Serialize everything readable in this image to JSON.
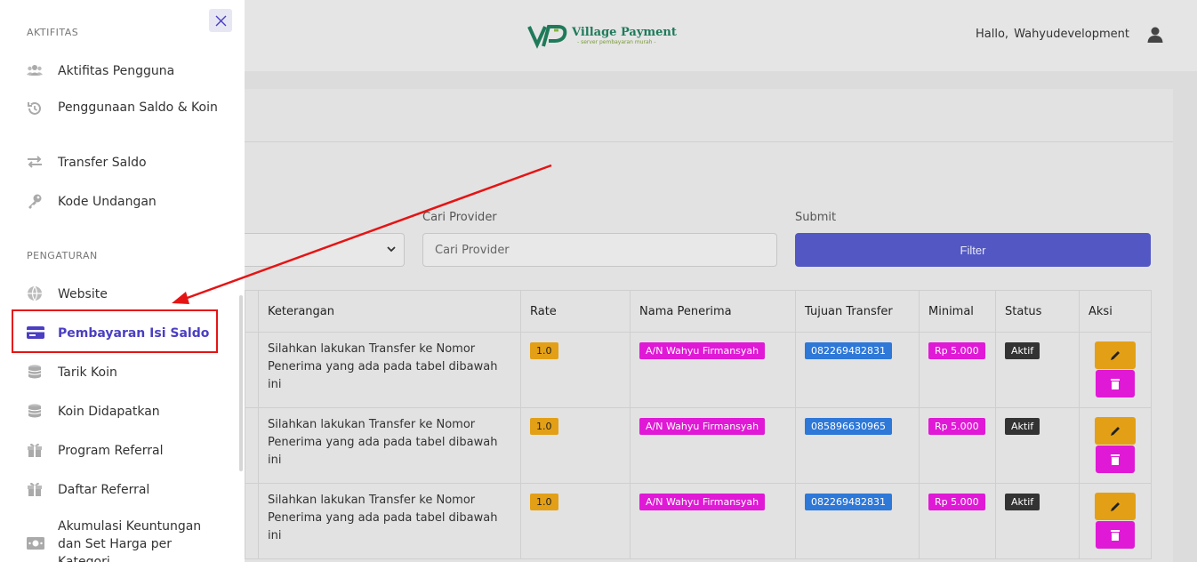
{
  "header": {
    "logo_title": "Village Payment",
    "logo_tagline": "- server pembayaran murah -",
    "greeting": "Hallo,",
    "username": "Wahyudevelopment"
  },
  "filter": {
    "provider_label": "Cari Provider",
    "provider_placeholder": "Cari Provider",
    "submit_label": "Submit",
    "filter_button": "Filter"
  },
  "table": {
    "headers": [
      "Keterangan",
      "Rate",
      "Nama Penerima",
      "Tujuan Transfer",
      "Minimal",
      "Status",
      "Aksi"
    ],
    "rows": [
      {
        "keterangan": "Silahkan lakukan Transfer ke Nomor Penerima yang ada pada tabel dibawah ini",
        "rate": "1.0",
        "nama": "A/N Wahyu Firmansyah",
        "tujuan": "082269482831",
        "minimal": "Rp 5.000",
        "status": "Aktif"
      },
      {
        "keterangan": "Silahkan lakukan Transfer ke Nomor Penerima yang ada pada tabel dibawah ini",
        "rate": "1.0",
        "nama": "A/N Wahyu Firmansyah",
        "tujuan": "085896630965",
        "minimal": "Rp 5.000",
        "status": "Aktif"
      },
      {
        "keterangan": "Silahkan lakukan Transfer ke Nomor Penerima yang ada pada tabel dibawah ini",
        "rate": "1.0",
        "nama": "A/N Wahyu Firmansyah",
        "tujuan": "082269482831",
        "minimal": "Rp 5.000",
        "status": "Aktif"
      }
    ]
  },
  "sidebar": {
    "section_aktifitas": "AKTIFITAS",
    "section_pengaturan": "PENGATURAN",
    "items": [
      {
        "label": "Aktifitas Pengguna",
        "icon": "users-icon"
      },
      {
        "label": "Penggunaan Saldo & Koin",
        "icon": "history-icon"
      },
      {
        "label": "Transfer Saldo",
        "icon": "transfer-icon"
      },
      {
        "label": "Kode Undangan",
        "icon": "key-icon"
      },
      {
        "label": "Website",
        "icon": "globe-icon"
      },
      {
        "label": "Pembayaran Isi Saldo",
        "icon": "credit-card-icon",
        "active": true
      },
      {
        "label": "Tarik Koin",
        "icon": "coins-icon"
      },
      {
        "label": "Koin Didapatkan",
        "icon": "coins-icon"
      },
      {
        "label": "Program Referral",
        "icon": "gift-icon"
      },
      {
        "label": "Daftar Referral",
        "icon": "gift-icon"
      },
      {
        "label": "Akumulasi Keuntungan dan Set Harga per Kategori",
        "icon": "money-icon"
      }
    ]
  },
  "colors": {
    "accent": "#5257c3",
    "active_nav": "#4a3fc2",
    "annotation_red": "#e51414",
    "badge_magenta": "#e019d6",
    "badge_blue": "#2e78d8",
    "badge_orange": "#e3a016"
  }
}
